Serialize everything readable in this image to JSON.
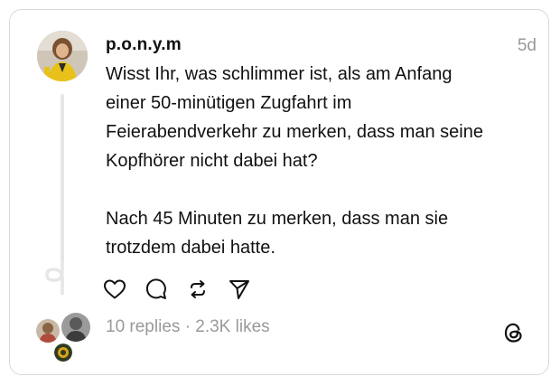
{
  "post": {
    "username": "p.o.n.y.m",
    "timestamp": "5d",
    "text": "Wisst Ihr, was schlimmer ist, als am Anfang\neiner 50-minütigen Zugfahrt im\nFeierabendverkehr zu merken, dass man seine\nKopfhörer nicht dabei hat?\n\nNach 45 Minuten zu merken, dass man sie\ntrotzdem dabei hatte."
  },
  "actions": [
    {
      "icon": "heart-icon"
    },
    {
      "icon": "comment-icon"
    },
    {
      "icon": "repost-icon"
    },
    {
      "icon": "share-icon"
    }
  ],
  "stats": {
    "text": "10 replies · 2.3K likes"
  },
  "colors": {
    "text": "#111111",
    "muted": "#999999",
    "border": "#d9d9d9",
    "avatar_jacket": "#e8c21a"
  }
}
